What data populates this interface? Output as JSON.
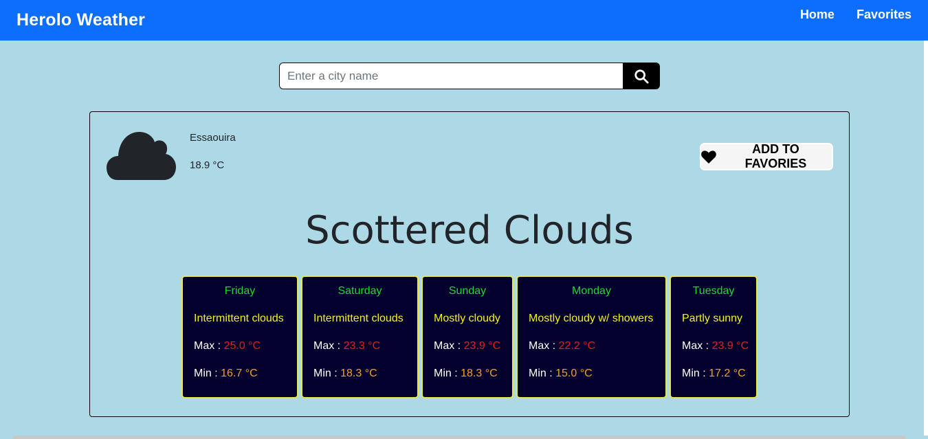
{
  "navbar": {
    "brand": "Herolo Weather",
    "links": [
      "Home",
      "Favorites"
    ]
  },
  "search": {
    "placeholder": "Enter a city name",
    "value": "",
    "icon": "search-icon"
  },
  "current": {
    "icon": "cloud-icon",
    "city": "Essaouira",
    "temperature": "18.9 °C",
    "favorite_label": "ADD TO FAVORIES",
    "favorite_icon": "heart-icon",
    "headline": "Scottered Clouds"
  },
  "forecast": [
    {
      "day": "Friday",
      "text": "Intermittent clouds",
      "max_label": "Max :",
      "max": "25.0 °C",
      "min_label": "Min :",
      "min": "16.7 °C"
    },
    {
      "day": "Saturday",
      "text": "Intermittent clouds",
      "max_label": "Max :",
      "max": "23.3 °C",
      "min_label": "Min :",
      "min": "18.3 °C"
    },
    {
      "day": "Sunday",
      "text": "Mostly cloudy",
      "max_label": "Max :",
      "max": "23.9 °C",
      "min_label": "Min :",
      "min": "18.3 °C"
    },
    {
      "day": "Monday",
      "text": "Mostly cloudy w/ showers",
      "max_label": "Max :",
      "max": "22.2 °C",
      "min_label": "Min :",
      "min": "15.0 °C"
    },
    {
      "day": "Tuesday",
      "text": "Partly sunny",
      "max_label": "Max :",
      "max": "23.9 °C",
      "min_label": "Min :",
      "min": "17.2 °C"
    }
  ],
  "colors": {
    "navbar": "#0d6efd",
    "background": "#add8e6",
    "forecast_bg": "#04002e",
    "day_name": "#1fd933",
    "condition": "#f2f21a",
    "max": "#ef1a1a",
    "min": "#f5a21a"
  }
}
